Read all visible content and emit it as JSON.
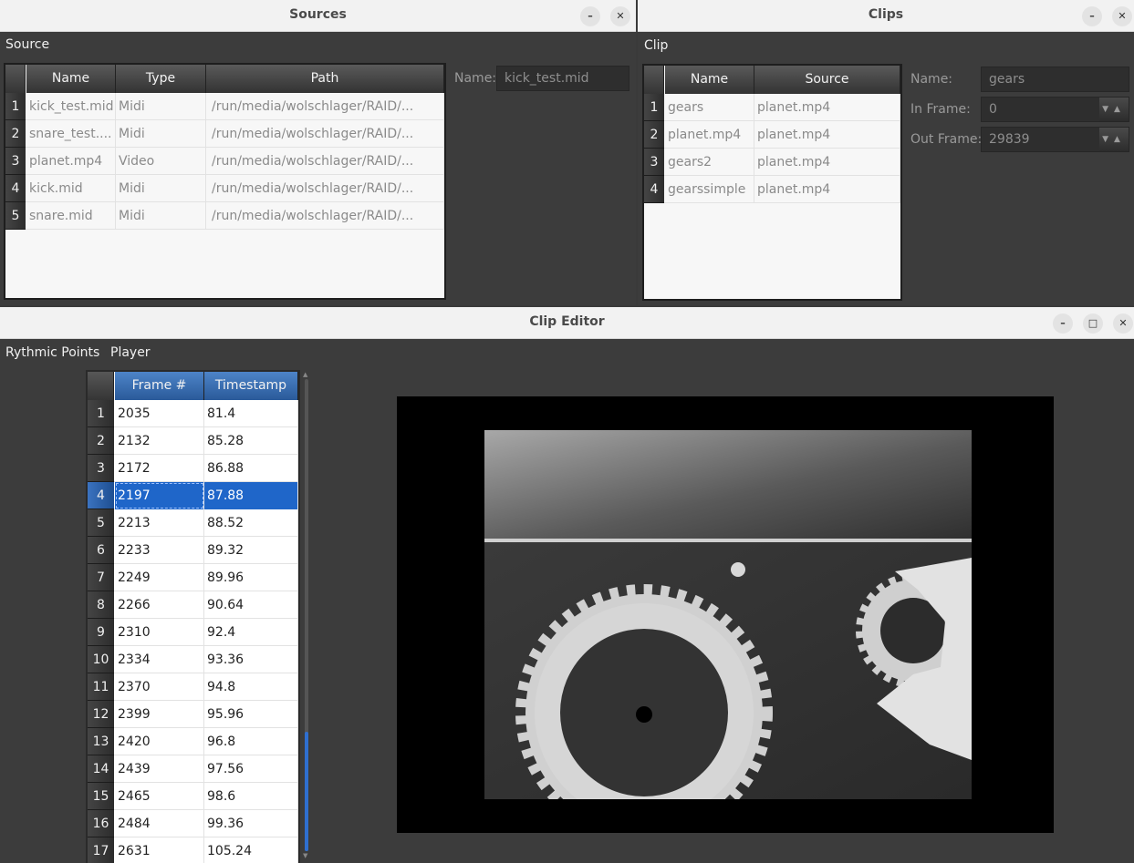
{
  "sources": {
    "window_title": "Sources",
    "section_label": "Source",
    "columns": [
      "Name",
      "Type",
      "Path"
    ],
    "rows": [
      {
        "num": "1",
        "name": "kick_test.mid",
        "type": "Midi",
        "path": "/run/media/wolschlager/RAID/..."
      },
      {
        "num": "2",
        "name": "snare_test....",
        "type": "Midi",
        "path": "/run/media/wolschlager/RAID/..."
      },
      {
        "num": "3",
        "name": "planet.mp4",
        "type": "Video",
        "path": "/run/media/wolschlager/RAID/..."
      },
      {
        "num": "4",
        "name": "kick.mid",
        "type": "Midi",
        "path": "/run/media/wolschlager/RAID/..."
      },
      {
        "num": "5",
        "name": "snare.mid",
        "type": "Midi",
        "path": "/run/media/wolschlager/RAID/..."
      }
    ],
    "name_label": "Name:",
    "name_value": "kick_test.mid"
  },
  "clips": {
    "window_title": "Clips",
    "section_label": "Clip",
    "columns": [
      "Name",
      "Source"
    ],
    "rows": [
      {
        "num": "1",
        "name": "gears",
        "source": "planet.mp4"
      },
      {
        "num": "2",
        "name": "planet.mp4",
        "source": "planet.mp4"
      },
      {
        "num": "3",
        "name": "gears2",
        "source": "planet.mp4"
      },
      {
        "num": "4",
        "name": "gearssimple",
        "source": "planet.mp4"
      }
    ],
    "name_label": "Name:",
    "name_value": "gears",
    "in_label": "In Frame:",
    "in_value": "0",
    "out_label": "Out Frame:",
    "out_value": "29839"
  },
  "editor": {
    "window_title": "Clip Editor",
    "menu_points": "Rythmic Points",
    "menu_player": "Player",
    "columns": [
      "Frame #",
      "Timestamp"
    ],
    "selected_row": 4,
    "rows": [
      {
        "num": "1",
        "frame": "2035",
        "ts": "81.4"
      },
      {
        "num": "2",
        "frame": "2132",
        "ts": "85.28"
      },
      {
        "num": "3",
        "frame": "2172",
        "ts": "86.88"
      },
      {
        "num": "4",
        "frame": "2197",
        "ts": "87.88"
      },
      {
        "num": "5",
        "frame": "2213",
        "ts": "88.52"
      },
      {
        "num": "6",
        "frame": "2233",
        "ts": "89.32"
      },
      {
        "num": "7",
        "frame": "2249",
        "ts": "89.96"
      },
      {
        "num": "8",
        "frame": "2266",
        "ts": "90.64"
      },
      {
        "num": "9",
        "frame": "2310",
        "ts": "92.4"
      },
      {
        "num": "10",
        "frame": "2334",
        "ts": "93.36"
      },
      {
        "num": "11",
        "frame": "2370",
        "ts": "94.8"
      },
      {
        "num": "12",
        "frame": "2399",
        "ts": "95.96"
      },
      {
        "num": "13",
        "frame": "2420",
        "ts": "96.8"
      },
      {
        "num": "14",
        "frame": "2439",
        "ts": "97.56"
      },
      {
        "num": "15",
        "frame": "2465",
        "ts": "98.6"
      },
      {
        "num": "16",
        "frame": "2484",
        "ts": "99.36"
      },
      {
        "num": "17",
        "frame": "2631",
        "ts": "105.24"
      }
    ]
  },
  "colors": {
    "selection": "#1f66c9",
    "window_bg": "#3c3c3c",
    "titlebar_bg": "#f2f2f2"
  },
  "icons": [
    "minimize-icon",
    "maximize-icon",
    "close-icon",
    "spin-up-icon",
    "spin-down-icon"
  ]
}
